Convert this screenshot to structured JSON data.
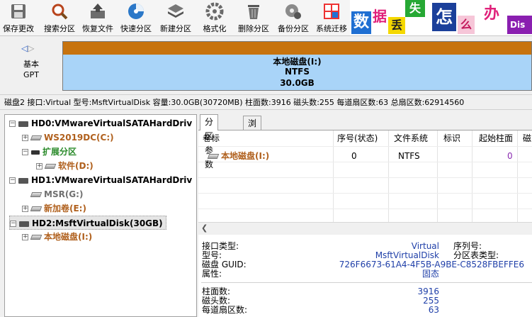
{
  "toolbar": {
    "buttons": [
      {
        "label": "保存更改",
        "icon": "save-icon"
      },
      {
        "label": "搜索分区",
        "icon": "search-icon"
      },
      {
        "label": "恢复文件",
        "icon": "restore-icon"
      },
      {
        "label": "快速分区",
        "icon": "quick-partition-icon"
      },
      {
        "label": "新建分区",
        "icon": "new-partition-icon"
      },
      {
        "label": "格式化",
        "icon": "format-icon"
      },
      {
        "label": "删除分区",
        "icon": "delete-icon"
      },
      {
        "label": "备份分区",
        "icon": "backup-icon"
      },
      {
        "label": "系统迁移",
        "icon": "migrate-icon"
      }
    ],
    "banner": {
      "chars": [
        "数",
        "据",
        "丢",
        "失",
        "怎",
        "么",
        "办"
      ],
      "tail": "Dis"
    }
  },
  "disk_bar": {
    "basic": "基本",
    "gpt": "GPT",
    "partition": {
      "name": "本地磁盘(I:)",
      "fs": "NTFS",
      "size": "30.0GB"
    }
  },
  "info_line": "磁盘2 接口:Virtual  型号:MsftVirtualDisk  容量:30.0GB(30720MB)  柱面数:3916  磁头数:255  每道扇区数:63  总扇区数:62914560",
  "tree": {
    "hd0": "HD0:VMwareVirtualSATAHardDriv",
    "ws2019": "WS2019DC(C:)",
    "extended": "扩展分区",
    "software": "软件(D:)",
    "hd1": "HD1:VMwareVirtualSATAHardDriv",
    "msr": "MSR(G:)",
    "newvol": "新加卷(E:)",
    "hd2": "HD2:MsftVirtualDisk(30GB)",
    "local": "本地磁盘(I:)"
  },
  "tabs": {
    "params": "分区参数",
    "browse": "浏览文件"
  },
  "grid": {
    "headers": {
      "label": "卷标",
      "seq": "序号(状态)",
      "fs": "文件系统",
      "flag": "标识",
      "start_cyl": "起始柱面",
      "more": "磁"
    },
    "row": {
      "label": "本地磁盘(I:)",
      "seq": "0",
      "fs": "NTFS",
      "start_cyl": "0"
    }
  },
  "details": {
    "iface_label": "接口类型:",
    "iface_value": "Virtual",
    "serial_label": "序列号:",
    "model_label": "型号:",
    "model_value": "MsftVirtualDisk",
    "ptable_label": "分区表类型:",
    "guid_label": "磁盘 GUID:",
    "guid_value": "726F6673-61A4-4F5B-A9BE-C8528FBEFFE6",
    "attr_label": "属性:",
    "attr_value": "固态",
    "cyl_label": "柱面数:",
    "cyl_value": "3916",
    "heads_label": "磁头数:",
    "heads_value": "255",
    "spt_label": "每道扇区数:",
    "spt_value": "63"
  },
  "colors": {
    "partition_fill": "#a9d4f8",
    "partition_strip": "#c7730e",
    "value_blue": "#1f3fa8",
    "brown": "#b0601d",
    "green": "#2a8a2a"
  }
}
